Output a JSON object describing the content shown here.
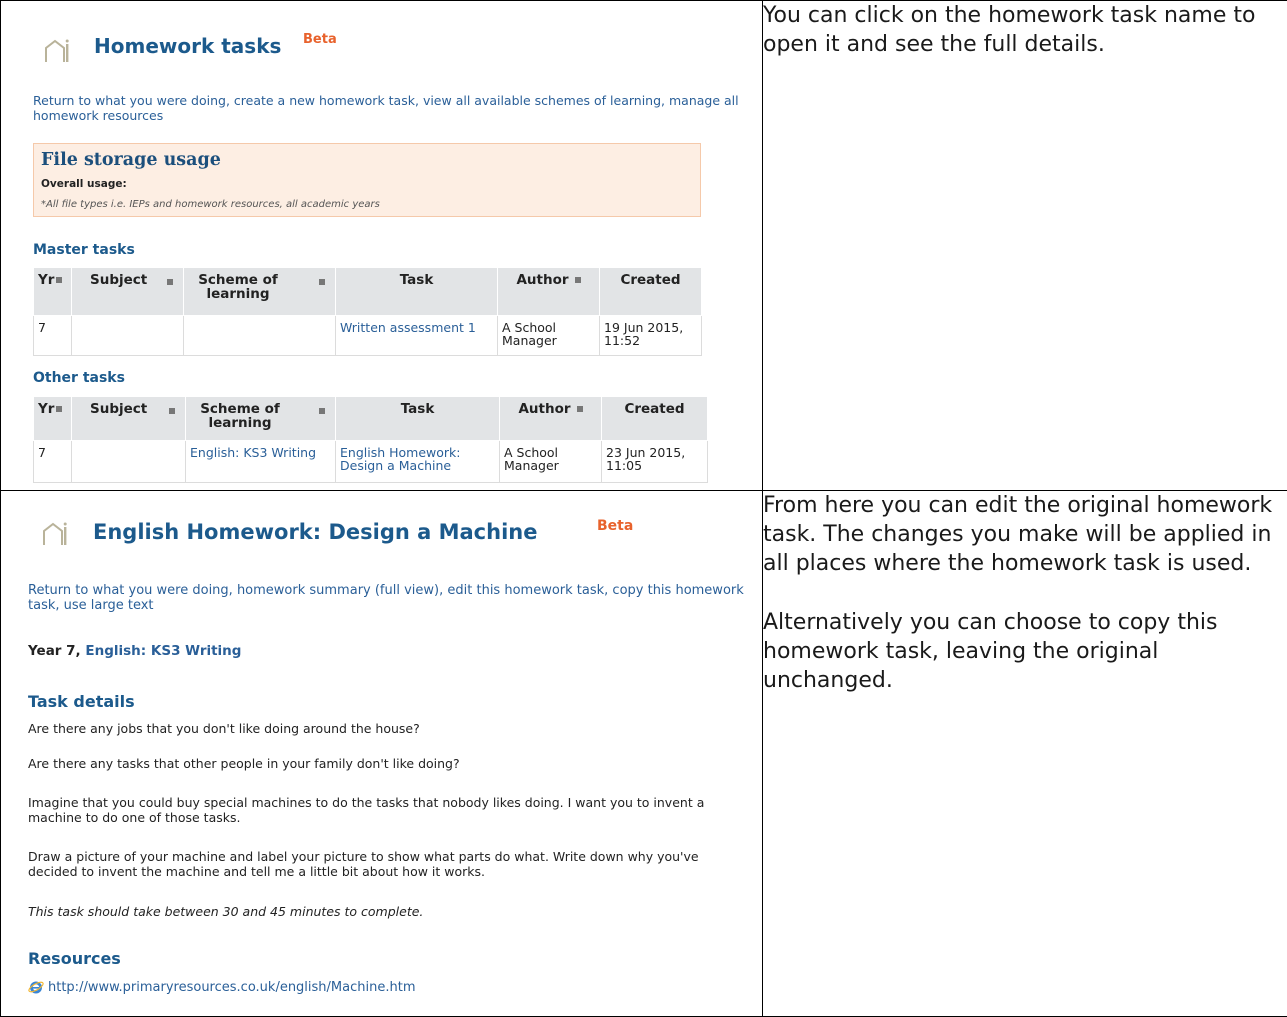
{
  "top": {
    "title": "Homework tasks",
    "beta": "Beta",
    "links": [
      "Return to what you were doing",
      "create a new homework task",
      "view all available schemes of learning",
      "manage all homework resources"
    ],
    "storage": {
      "heading": "File storage usage",
      "label": "Overall usage:",
      "note": "*All file types i.e. IEPs and homework resources, all academic years"
    },
    "columns": [
      "Yr",
      "Subject",
      "Scheme of learning",
      "Task",
      "Author",
      "Created"
    ],
    "master": {
      "heading": "Master tasks",
      "rows": [
        {
          "yr": "7",
          "subject": "",
          "scheme": "",
          "task": "Written assessment 1",
          "author": "A School Manager",
          "created": "19 Jun 2015, 11:52"
        }
      ]
    },
    "other": {
      "heading": "Other tasks",
      "rows": [
        {
          "yr": "7",
          "subject": "",
          "scheme": "English: KS3 Writing",
          "task": "English Homework: Design a Machine",
          "author": "A School Manager",
          "created": "23 Jun 2015, 11:05"
        }
      ]
    }
  },
  "top_note": "You can click on the homework task name to open it and see the full details.",
  "bottom": {
    "title": "English Homework: Design a Machine",
    "beta": "Beta",
    "links": [
      "Return to what you were doing",
      "homework summary (full view)",
      "edit this homework task",
      "copy this homework task",
      "use large text"
    ],
    "year": "Year 7,",
    "scheme": "English: KS3 Writing",
    "details_heading": "Task details",
    "details": [
      "Are there any jobs that you don't like doing around the house?",
      "Are there any tasks that other people in your family don't like doing?",
      "Imagine that you could buy special machines to do the tasks that nobody likes doing. I want you to invent a machine to do one of those tasks.",
      "Draw a picture of your machine and label your picture to show what parts do what. Write down why you've decided to invent the machine and tell me a little bit about how it works.",
      "This task should take between 30 and 45 minutes to complete."
    ],
    "resources_heading": "Resources",
    "resource_url": "http://www.primaryresources.co.uk/english/Machine.htm"
  },
  "bottom_note": {
    "p1": "From here you can edit the original homework task. The changes you make will be applied in all places where the homework task is used.",
    "p2": "Alternatively you can choose to copy this homework task, leaving the original unchanged."
  }
}
